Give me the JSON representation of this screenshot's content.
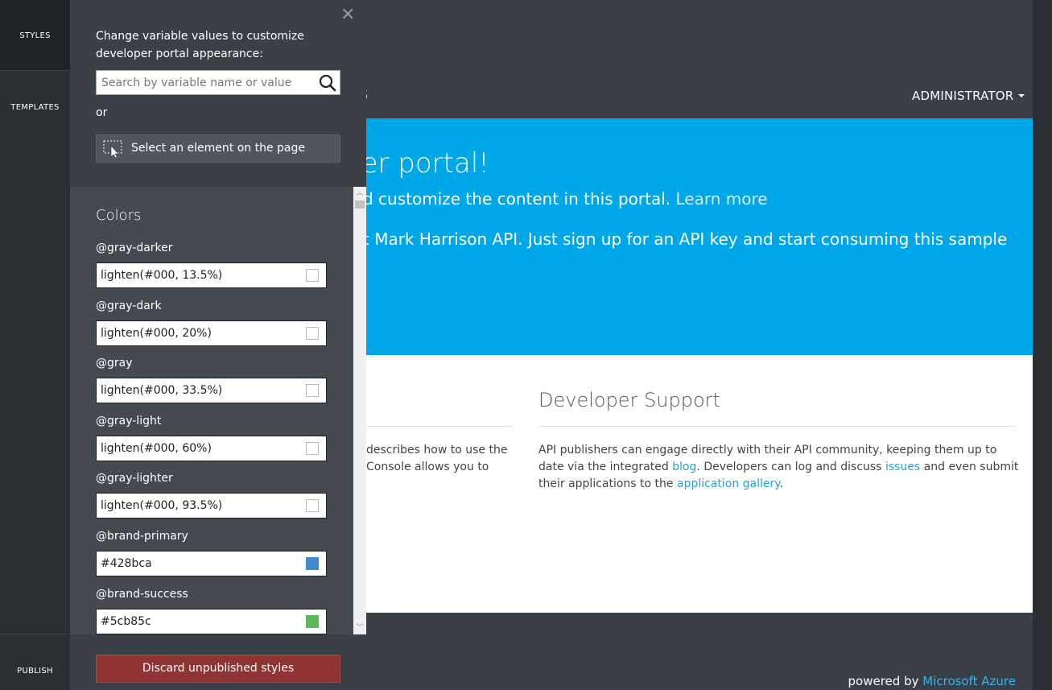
{
  "rail": {
    "styles_label": "STYLES",
    "templates_label": "TEMPLATES",
    "publish_label": "PUBLISH"
  },
  "panel": {
    "close_glyph": "×",
    "intro": "Change variable values to customize developer portal appearance:",
    "search": {
      "placeholder": "Search by variable name or value",
      "value": ""
    },
    "or_label": "or",
    "select_button": "Select an element on the page",
    "section_heading": "Colors",
    "variables": [
      {
        "name": "@gray-darker",
        "value": "lighten(#000, 13.5%)",
        "swatch": "#ffffff"
      },
      {
        "name": "@gray-dark",
        "value": "lighten(#000, 20%)",
        "swatch": "#ffffff"
      },
      {
        "name": "@gray",
        "value": "lighten(#000, 33.5%)",
        "swatch": "#ffffff"
      },
      {
        "name": "@gray-light",
        "value": "lighten(#000, 60%)",
        "swatch": "#ffffff"
      },
      {
        "name": "@gray-lighter",
        "value": "lighten(#000, 93.5%)",
        "swatch": "#ffffff"
      },
      {
        "name": "@brand-primary",
        "value": "#428bca",
        "swatch": "#428bca"
      },
      {
        "name": "@brand-success",
        "value": "#5cb85c",
        "swatch": "#5cb85c"
      }
    ],
    "discard_button": "Discard unpublished styles"
  },
  "portal": {
    "nav_fragment": "S",
    "admin_label": "ADMINISTRATOR",
    "hero": {
      "title_fragment": "per portal!",
      "subtitle_fragment": "d customize the content in this portal.",
      "learn_more": "Learn more",
      "line_fragment": "t Mark Harrison API. Just sign up for an API key and start consuming this sample"
    },
    "left_column": {
      "line1": "describes how to use the",
      "line2": "Console allows you to"
    },
    "developer_support": {
      "title": "Developer Support",
      "text1": "API publishers can engage directly with their API community, keeping them up to date via the integrated ",
      "blog": "blog",
      "text2": ". Developers can log and discuss ",
      "issues": "issues",
      "text3": " and even submit their applications to the ",
      "gallery": "application gallery",
      "text4": "."
    },
    "footer": {
      "powered_by": "powered by",
      "azure": "Microsoft Azure"
    }
  },
  "colors": {
    "hero_blue": "#00a7e8",
    "discard_red": "#8f3333",
    "link_blue": "#1fa3dc"
  }
}
